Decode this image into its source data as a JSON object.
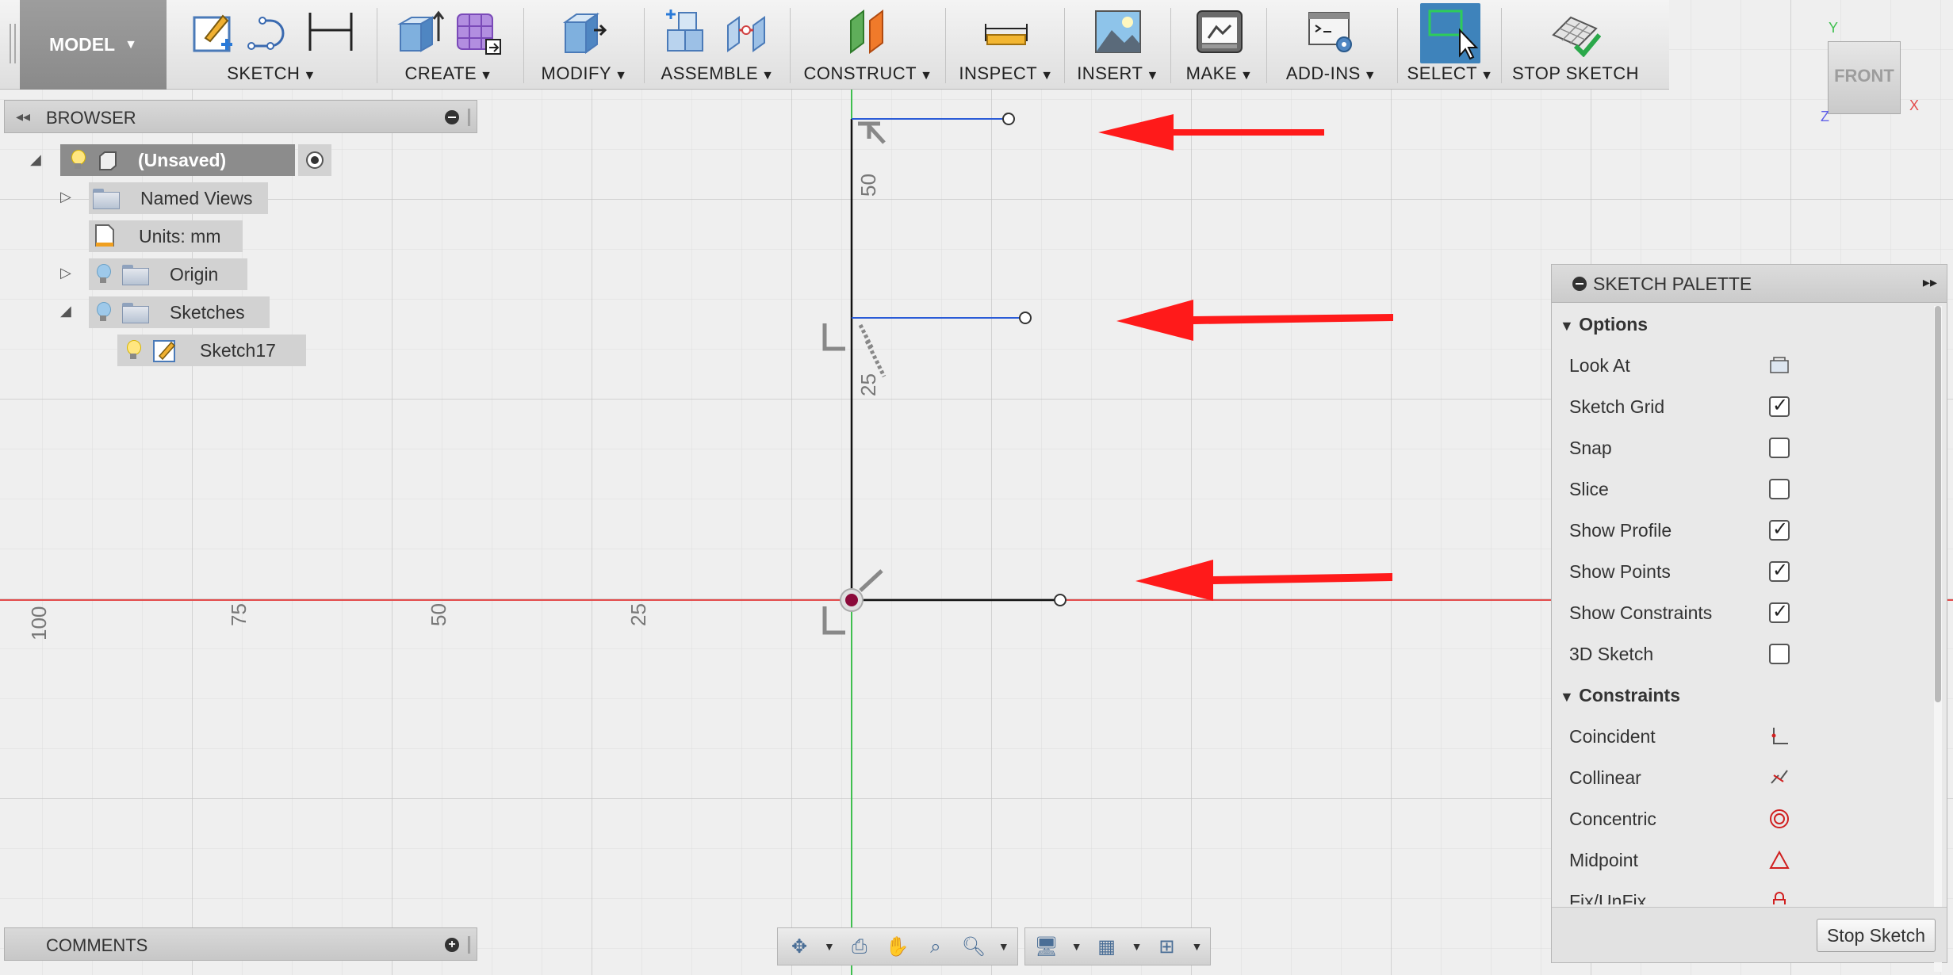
{
  "toolbar": {
    "workspace_label": "MODEL",
    "groups": {
      "sketch": "SKETCH",
      "create": "CREATE",
      "modify": "MODIFY",
      "assemble": "ASSEMBLE",
      "construct": "CONSTRUCT",
      "inspect": "INSPECT",
      "insert": "INSERT",
      "make": "MAKE",
      "addins": "ADD-INS",
      "select": "SELECT",
      "stop_sketch": "STOP SKETCH"
    }
  },
  "browser": {
    "title": "BROWSER",
    "items": [
      {
        "label": "(Unsaved)",
        "icon": "component-icon"
      },
      {
        "label": "Named Views",
        "icon": "folder-icon"
      },
      {
        "label": "Units: mm",
        "icon": "document-icon"
      },
      {
        "label": "Origin",
        "icon": "folder-icon"
      },
      {
        "label": "Sketches",
        "icon": "folder-icon"
      },
      {
        "label": "Sketch17",
        "icon": "sketch-icon"
      }
    ]
  },
  "comments": {
    "title": "COMMENTS"
  },
  "viewcube": {
    "face": "FRONT",
    "axis_y": "Y",
    "axis_x": "X",
    "axis_z": "Z"
  },
  "canvas": {
    "ruler_labels": [
      "100",
      "75",
      "50",
      "25"
    ],
    "dimension_labels": [
      "50",
      "25"
    ],
    "colors": {
      "x_axis": "#e34b4b",
      "y_axis": "#3fbf4f",
      "selected_line": "#2a5bd7",
      "arrow": "#ff1a1a",
      "origin": "#8b0a3a"
    }
  },
  "palette": {
    "title": "SKETCH PALETTE",
    "sections": {
      "options": "Options",
      "constraints": "Constraints"
    },
    "options": [
      {
        "label": "Look At",
        "control": "button"
      },
      {
        "label": "Sketch Grid",
        "control": "checkbox",
        "checked": true
      },
      {
        "label": "Snap",
        "control": "checkbox",
        "checked": false
      },
      {
        "label": "Slice",
        "control": "checkbox",
        "checked": false
      },
      {
        "label": "Show Profile",
        "control": "checkbox",
        "checked": true
      },
      {
        "label": "Show Points",
        "control": "checkbox",
        "checked": true
      },
      {
        "label": "Show Constraints",
        "control": "checkbox",
        "checked": true
      },
      {
        "label": "3D Sketch",
        "control": "checkbox",
        "checked": false
      }
    ],
    "constraints": [
      {
        "label": "Coincident",
        "icon": "coincident-icon"
      },
      {
        "label": "Collinear",
        "icon": "collinear-icon"
      },
      {
        "label": "Concentric",
        "icon": "concentric-icon"
      },
      {
        "label": "Midpoint",
        "icon": "midpoint-icon"
      },
      {
        "label": "Fix/UnFix",
        "icon": "lock-icon"
      }
    ],
    "stop_button": "Stop Sketch"
  }
}
